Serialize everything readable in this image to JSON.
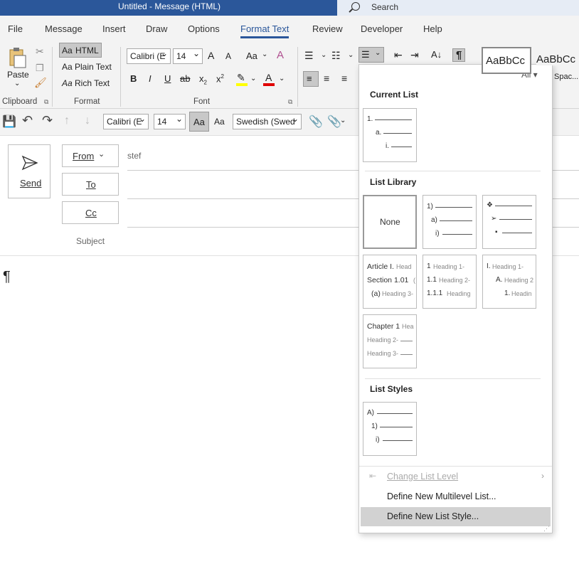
{
  "titlebar": {
    "title": "Untitled  -  Message (HTML)",
    "search_placeholder": "Search"
  },
  "menu": {
    "tabs": [
      "File",
      "Message",
      "Insert",
      "Draw",
      "Options",
      "Format Text",
      "Review",
      "Developer",
      "Help"
    ],
    "active": "Format Text"
  },
  "ribbon": {
    "clipboard": {
      "paste": "Paste",
      "label": "Clipboard"
    },
    "format": {
      "html": "HTML",
      "plain": "Plain Text",
      "rich": "Rich Text",
      "label": "Format",
      "aa": "Aa"
    },
    "font": {
      "name": "Calibri (E",
      "size": "14",
      "label": "Font",
      "bold": "B",
      "italic": "I",
      "underline": "U",
      "strike": "ab",
      "sub": "x",
      "sup": "x",
      "grow": "A",
      "shrink": "A",
      "case": "Aa"
    },
    "styles": {
      "style1": "AaBbCc",
      "style2": "AaBbCc",
      "style2_label": "Spac..."
    }
  },
  "qat": {
    "font": "Calibri (E",
    "size": "14",
    "aa1": "Aa",
    "aa2": "Aa",
    "language": "Swedish (Swed"
  },
  "header": {
    "send": "Send",
    "from": "From",
    "from_value": "stef",
    "to": "To",
    "cc": "Cc",
    "subject": "Subject"
  },
  "body": {
    "pilcrow": "¶"
  },
  "dropdown": {
    "filter": "All",
    "current_list": "Current List",
    "list_library": "List Library",
    "none": "None",
    "list_styles": "List Styles",
    "change_level": "Change List Level",
    "define_multilevel": "Define New Multilevel List...",
    "define_style": "Define New List Style...",
    "current": {
      "l1": "1.",
      "l2": "a.",
      "l3": "i."
    },
    "lib1": {
      "l1": "1)",
      "l2": "a)",
      "l3": "i)"
    },
    "lib2": {
      "l1": "❖",
      "l2": "➢",
      "l3": "▪"
    },
    "lib3": {
      "a": "Article I.",
      "ah": "Head",
      "b": "Section 1.01",
      "bh": "(",
      "c": "(a)",
      "ch": "Heading 3-"
    },
    "lib4": {
      "a": "1",
      "ah": "Heading 1-",
      "b": "1.1",
      "bh": "Heading 2-",
      "c": "1.1.1",
      "ch": "Heading"
    },
    "lib5": {
      "a": "I.",
      "ah": "Heading 1-",
      "b": "A.",
      "bh": "Heading 2",
      "c": "1.",
      "ch": "Headin"
    },
    "lib6": {
      "a": "Chapter 1",
      "ah": "Hea",
      "b": "Heading 2-",
      "c": "Heading 3-"
    },
    "style1": {
      "l1": "A)",
      "l2": "1)",
      "l3": "i)"
    }
  }
}
